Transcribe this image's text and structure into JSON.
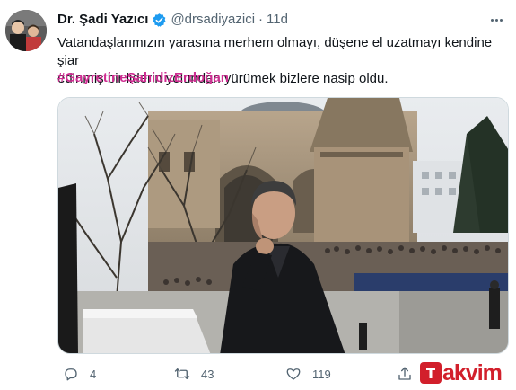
{
  "tweet": {
    "author_name": "Dr. Şadi Yazıcı",
    "handle": "@drsadiyazici",
    "separator": "·",
    "time": "11d",
    "text_line1": "Vatandaşlarımızın yarasına merhem olmayı, düşene el uzatmayı kendine şiar",
    "text_line2": "edinmiş bir liderin yolundan yürümek bizlere nasip oldu.",
    "hashtag": "#GayretineŞahidizErdoğan"
  },
  "actions": {
    "reply_count": "4",
    "retweet_count": "43",
    "like_count": "119"
  },
  "watermark": {
    "text": "akvim"
  },
  "icons": {
    "verified": "verified-badge-icon",
    "more": "more-options-icon",
    "reply": "reply-icon",
    "retweet": "retweet-icon",
    "like": "like-icon",
    "share": "share-icon"
  },
  "colors": {
    "hashtag": "#cf2e92",
    "verified": "#1d9bf0",
    "secondary_text": "#536471",
    "watermark": "#d21f2b"
  }
}
